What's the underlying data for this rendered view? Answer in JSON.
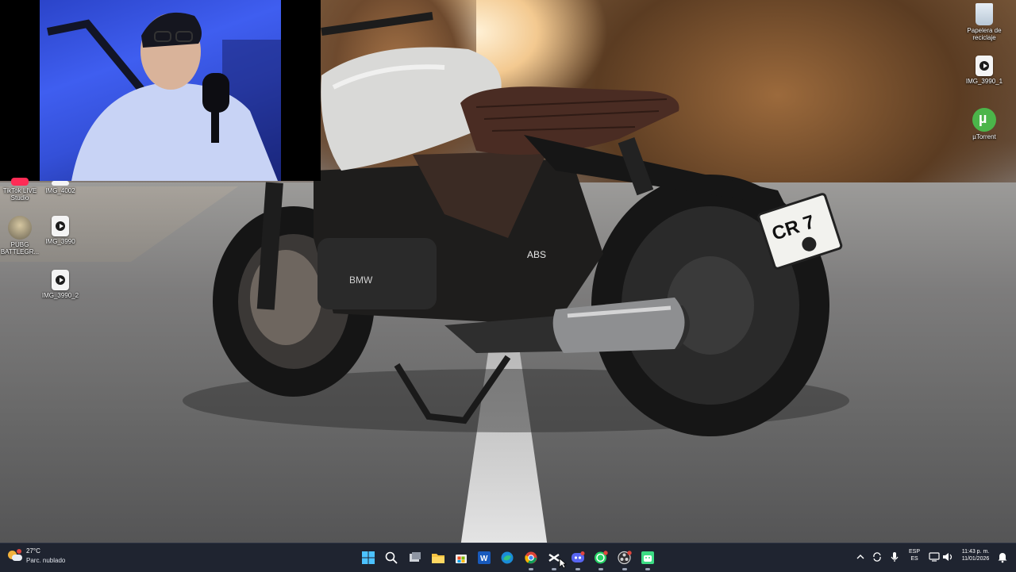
{
  "desktop": {
    "icons": [
      {
        "label": "Papelera de reciclaje",
        "icon": "recycle-bin-icon"
      },
      {
        "label": "IMG_3990_1",
        "icon": "video-file-icon"
      },
      {
        "label": "µTorrent",
        "icon": "utorrent-icon"
      },
      {
        "label": "TikTok LIVE Studio",
        "icon": "tiktok-live-studio-icon"
      },
      {
        "label": "IMG_4002",
        "icon": "video-file-icon"
      },
      {
        "label": "PUBG BATTLEGR...",
        "icon": "pubg-icon"
      },
      {
        "label": "IMG_3990",
        "icon": "video-file-icon"
      },
      {
        "label": "IMG_3990_2",
        "icon": "video-file-icon"
      }
    ]
  },
  "wallpaper": {
    "plate_text": "CR 7",
    "badge_abs": "ABS",
    "engine_brand": "BMW"
  },
  "taskbar": {
    "weather": {
      "temp": "27°C",
      "desc": "Parc. nublado",
      "icon": "weather-cloudy-icon"
    },
    "apps": [
      {
        "name": "start-button",
        "icon": "windows-start-icon"
      },
      {
        "name": "search-button",
        "icon": "search-icon"
      },
      {
        "name": "task-view-button",
        "icon": "task-view-icon"
      },
      {
        "name": "file-explorer-button",
        "icon": "folder-icon"
      },
      {
        "name": "microsoft-store-button",
        "icon": "store-icon"
      },
      {
        "name": "word-button",
        "icon": "word-icon"
      },
      {
        "name": "edge-button",
        "icon": "edge-icon"
      },
      {
        "name": "chrome-button",
        "icon": "chrome-icon"
      },
      {
        "name": "capcut-button",
        "icon": "capcut-icon"
      },
      {
        "name": "discord-button",
        "icon": "discord-icon"
      },
      {
        "name": "whatsapp-button",
        "icon": "whatsapp-icon"
      },
      {
        "name": "obs-button",
        "icon": "obs-icon"
      },
      {
        "name": "android-app-button",
        "icon": "android-icon"
      }
    ],
    "tray": {
      "language": "ESP",
      "layout": "ES",
      "time": "11:43 p. m.",
      "date": "11/01/2026"
    }
  },
  "colors": {
    "taskbar_bg": "#1f2430",
    "accent": "#3fa0ff"
  }
}
